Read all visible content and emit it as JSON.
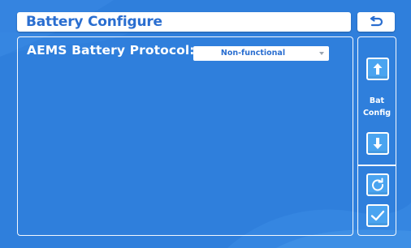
{
  "header": {
    "title": "Battery Configure",
    "back_icon": "return-arrow-icon"
  },
  "main": {
    "protocol_label": "AEMS Battery Protocol:",
    "protocol_value": "Non-functional"
  },
  "side": {
    "label_line1": "Bat",
    "label_line2": "Config",
    "buttons": [
      "arrow-up-icon",
      "arrow-down-icon",
      "refresh-icon",
      "check-icon"
    ]
  },
  "colors": {
    "background": "#2f7fdc",
    "accent": "#2a6ed0",
    "button_fill": "#4aa4f0"
  }
}
